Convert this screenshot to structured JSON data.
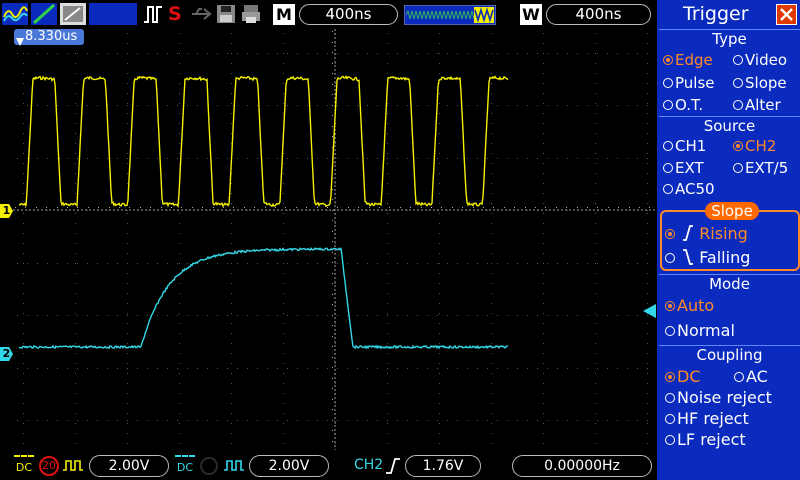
{
  "topbar": {
    "timebase": "400ns",
    "menu_label": "M",
    "window_label": "W",
    "window_timebase": "400ns",
    "stop_label": "S"
  },
  "scope": {
    "trigger_time": "8.330us",
    "ch1_marker": "1",
    "ch2_marker": "2"
  },
  "bottombar": {
    "ch1_coupling": "DC",
    "ch1_bw": "20",
    "ch1_scale": "2.00V",
    "ch2_coupling": "DC",
    "ch2_scale": "2.00V",
    "trig_source": "CH2",
    "trig_level": "1.76V",
    "frequency": "0.00000Hz"
  },
  "panel": {
    "title": "Trigger",
    "type": {
      "title": "Type",
      "edge": "Edge",
      "video": "Video",
      "pulse": "Pulse",
      "slope": "Slope",
      "ot": "O.T.",
      "alter": "Alter"
    },
    "source": {
      "title": "Source",
      "ch1": "CH1",
      "ch2": "CH2",
      "ext": "EXT",
      "ext5": "EXT/5",
      "ac50": "AC50"
    },
    "slope": {
      "title": "Slope",
      "rising": "Rising",
      "falling": "Falling"
    },
    "mode": {
      "title": "Mode",
      "auto": "Auto",
      "normal": "Normal"
    },
    "coupling": {
      "title": "Coupling",
      "dc": "DC",
      "ac": "AC",
      "noise": "Noise reject",
      "hf": "HF reject",
      "lf": "LF reject"
    }
  },
  "colors": {
    "ch1": "#f4f000",
    "ch2": "#33d8e8",
    "panel": "#0a2bbd",
    "accent": "#ff8a2a"
  }
}
